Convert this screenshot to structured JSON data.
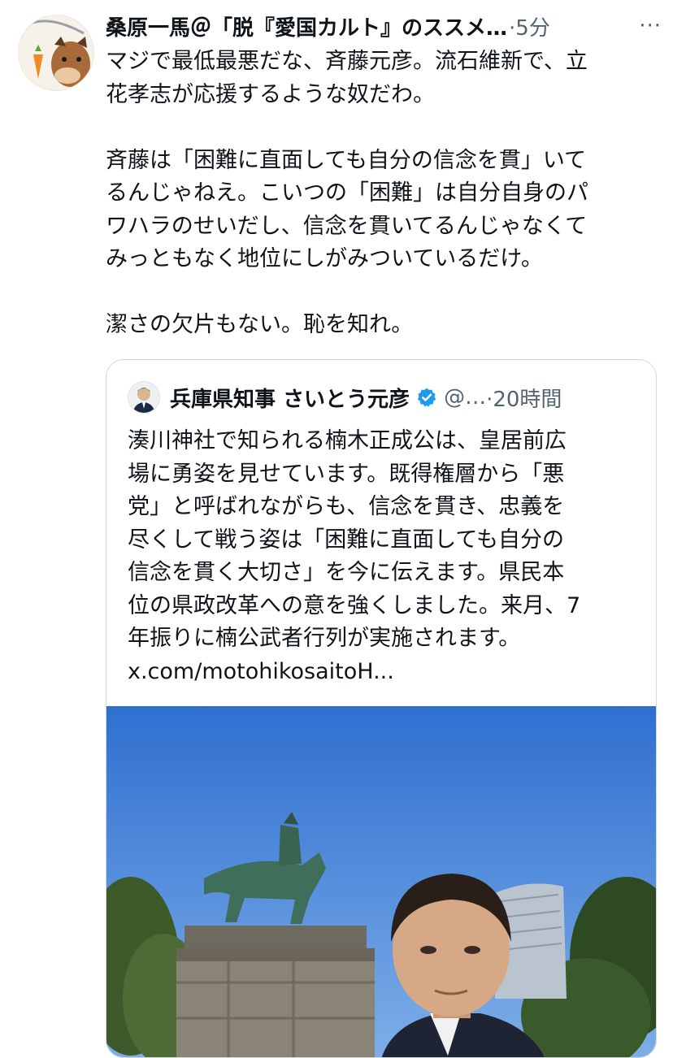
{
  "tweet": {
    "author_name": "桑原一馬＠「脱『愛国カルト』のススメ…",
    "time": "·5分",
    "more_icon": "ellipsis-icon",
    "avatar_icon": "horse-with-carrot-icon",
    "text": "マジで最低最悪だな、斉藤元彦。流石維新で、立\n花孝志が応援するような奴だわ。\n\n斉藤は「困難に直面しても自分の信念を貫」いて\nるんじゃねえ。こいつの「困難」は自分自身のパ\nワハラのせいだし、信念を貫いてるんじゃなくて\nみっともなく地位にしがみついているだけ。\n\n潔さの欠片もない。恥を知れ。"
  },
  "quote": {
    "name": "兵庫県知事 さいとう元彦",
    "verified_icon": "verified-badge-icon",
    "handle": "@…",
    "time": "·20時間",
    "text": "湊川神社で知られる楠木正成公は、皇居前広\n場に勇姿を見せています。既得権層から「悪\n党」と呼ばれながらも、信念を貫き、忠義を\n尽くして戦う姿は「困難に直面しても自分の\n信念を貫く大切さ」を今に伝えます。県民本\n位の県政改革への意を強くしました。来月、7\n年振りに楠公武者行列が実施されます。\nx.com/motohikosaitoH...",
    "photo_icon": "selfie-with-statue-photo"
  },
  "colors": {
    "text": "#0f1419",
    "secondary": "#536471",
    "border": "#cfd9de",
    "verified": "#1d9bf0",
    "sky": "#4a7fd6"
  }
}
